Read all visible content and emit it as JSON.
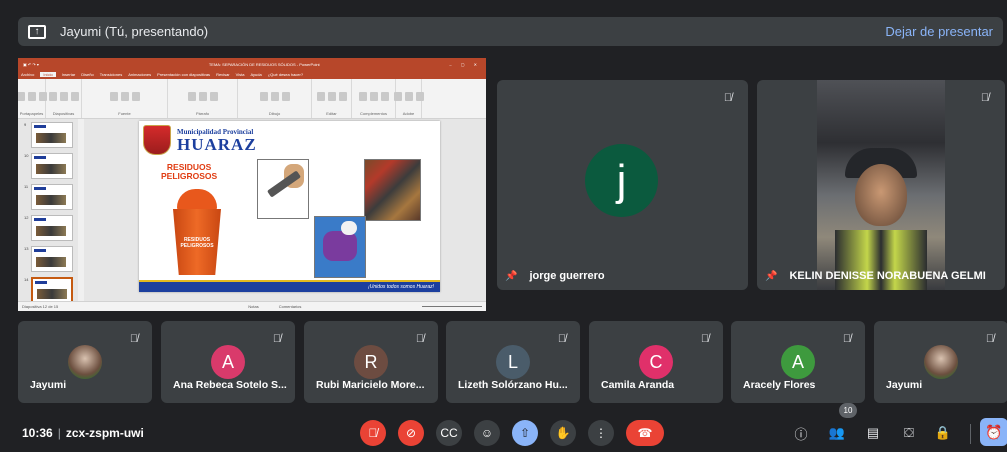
{
  "banner": {
    "title": "Jayumi (Tú, presentando)",
    "stop_label": "Dejar de presentar"
  },
  "presentation": {
    "window_title": "TEMA: SEPARACIÓN DE RESIDUOS SÓLIDOS - PowerPoint",
    "menu_tabs": [
      "Archivo",
      "Inicio",
      "Insertar",
      "Diseño",
      "Transiciones",
      "Animaciones",
      "Presentación con diapositivas",
      "Revisar",
      "Vista",
      "Ayuda",
      "¿Qué desea hacer?"
    ],
    "active_tab": "Inicio",
    "ribbon_groups": [
      "Portapapeles",
      "Diapositivas",
      "Fuente",
      "Párrafo",
      "Dibujo",
      "Editar",
      "Complementos",
      "Adobe"
    ],
    "slide_numbers": [
      "9",
      "10",
      "11",
      "12",
      "13",
      "14",
      "15"
    ],
    "selected_slide_index": 5,
    "slide": {
      "municipality": "Municipalidad Provincial",
      "city": "HUARAZ",
      "heading_line1": "RESIDUOS",
      "heading_line2": "PELIGROSOS",
      "bin_label_line1": "RESIDUOS",
      "bin_label_line2": "PELIGROSOS",
      "footer": "¡Unidos todos somos Huaraz!"
    },
    "status_left": "Diapositiva 12 de 15",
    "status_notes": "Notas",
    "status_comments": "Comentarios"
  },
  "tiles": {
    "jorge": {
      "name": "jorge guerrero",
      "initial": "j",
      "color": "#0b5a3e"
    },
    "kelin": {
      "name": "KELIN DENISSE NORABUENA GELMI"
    }
  },
  "participants": [
    {
      "name": "Jayumi",
      "initial": "",
      "color": "",
      "photo": true
    },
    {
      "name": "Ana Rebeca Sotelo S...",
      "initial": "A",
      "color": "#d93a6b",
      "photo": false
    },
    {
      "name": "Rubi Maricielo More...",
      "initial": "R",
      "color": "#6d4c41",
      "photo": false
    },
    {
      "name": "Lizeth Solórzano Hu...",
      "initial": "L",
      "color": "#4a5c6a",
      "photo": false
    },
    {
      "name": "Camila Aranda",
      "initial": "C",
      "color": "#e0306a",
      "photo": false
    },
    {
      "name": "Aracely Flores",
      "initial": "A",
      "color": "#3e9a3e",
      "photo": false
    },
    {
      "name": "Jayumi",
      "initial": "",
      "color": "",
      "photo": true
    }
  ],
  "bottom": {
    "time": "10:36",
    "meeting_code": "zcx-zspm-uwi",
    "participants_count": "10"
  },
  "icons": {
    "mic": "mic-off-icon",
    "camera": "videocam-off-icon",
    "captions": "captions-icon",
    "emoji": "emoji-icon",
    "present": "present-icon",
    "hand": "raise-hand-icon",
    "more": "more-vert-icon",
    "end": "call-end-icon"
  }
}
